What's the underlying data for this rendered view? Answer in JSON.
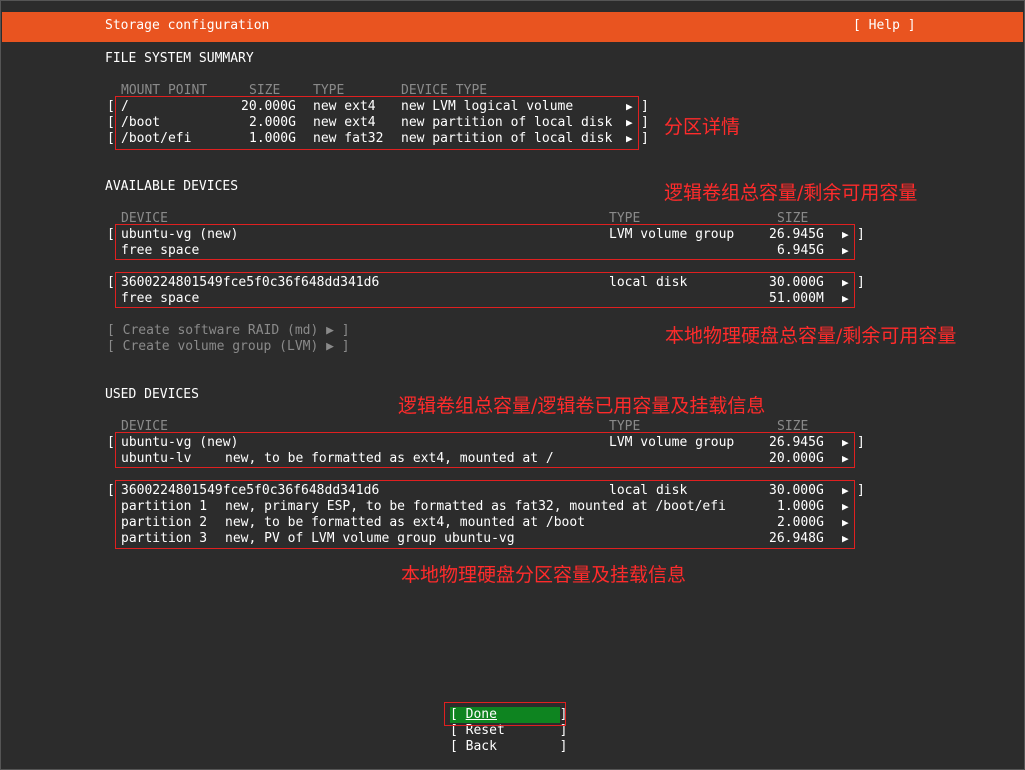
{
  "window": {
    "title": "Storage configuration",
    "help": "[ Help ]"
  },
  "fs_summary": {
    "heading": "FILE SYSTEM SUMMARY",
    "columns": [
      "MOUNT POINT",
      "SIZE",
      "TYPE",
      "DEVICE TYPE"
    ],
    "rows": [
      {
        "mount": "/",
        "size": "20.000G",
        "type": "new ext4",
        "device_type": "new LVM logical volume"
      },
      {
        "mount": "/boot",
        "size": "2.000G",
        "type": "new ext4",
        "device_type": "new partition of local disk"
      },
      {
        "mount": "/boot/efi",
        "size": "1.000G",
        "type": "new fat32",
        "device_type": "new partition of local disk"
      }
    ]
  },
  "available": {
    "heading": "AVAILABLE DEVICES",
    "columns": [
      "DEVICE",
      "TYPE",
      "SIZE"
    ],
    "groups": [
      {
        "device": "ubuntu-vg (new)",
        "type": "LVM volume group",
        "size": "26.945G",
        "free_label": "free space",
        "free_size": "6.945G"
      },
      {
        "device": "3600224801549fce5f0c36f648dd341d6",
        "type": "local disk",
        "size": "30.000G",
        "free_label": "free space",
        "free_size": "51.000M"
      }
    ],
    "actions": [
      "[ Create software RAID (md) ▶ ]",
      "[ Create volume group (LVM) ▶ ]"
    ]
  },
  "used": {
    "heading": "USED DEVICES",
    "columns": [
      "DEVICE",
      "TYPE",
      "SIZE"
    ],
    "vg": {
      "device": "ubuntu-vg (new)",
      "type": "LVM volume group",
      "size": "26.945G",
      "children": [
        {
          "name": "ubuntu-lv",
          "desc": "new, to be formatted as ext4, mounted at /",
          "size": "20.000G"
        }
      ]
    },
    "disk": {
      "device": "3600224801549fce5f0c36f648dd341d6",
      "type": "local disk",
      "size": "30.000G",
      "children": [
        {
          "name": "partition 1",
          "desc": "new, primary ESP, to be formatted as fat32, mounted at /boot/efi",
          "size": "1.000G"
        },
        {
          "name": "partition 2",
          "desc": "new, to be formatted as ext4, mounted at /boot",
          "size": "2.000G"
        },
        {
          "name": "partition 3",
          "desc": "new, PV of LVM volume group ubuntu-vg",
          "size": "26.948G"
        }
      ]
    }
  },
  "annotations": {
    "partition_details": "分区详情",
    "vg_capacity": "逻辑卷组总容量/剩余可用容量",
    "disk_capacity": "本地物理硬盘总容量/剩余可用容量",
    "vg_used": "逻辑卷组总容量/逻辑卷已用容量及挂载信息",
    "disk_partitions": "本地物理硬盘分区容量及挂载信息"
  },
  "buttons": {
    "done": "Done",
    "reset": "Reset",
    "back": "Back"
  },
  "glyphs": {
    "arrow": "▶",
    "lbr": "[",
    "rbr": "]"
  },
  "colors": {
    "accent": "#e95420",
    "background": "#2c2c2c",
    "annotation": "#ff2b2b",
    "selected": "#0e8420"
  }
}
